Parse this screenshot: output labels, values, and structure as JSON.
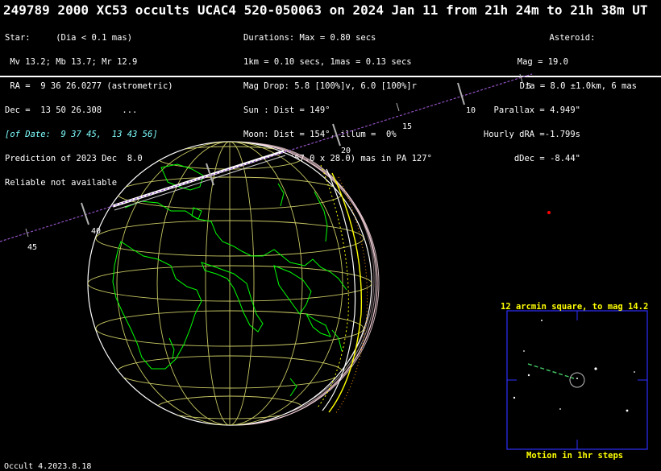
{
  "title": "249789 2000 XC53 occults UCAC4 520-050063 on 2024 Jan 11 from 21h 24m to 21h 38m UT",
  "star_block": [
    "Star:     (Dia < 0.1 mas)",
    " Mv 13.2; Mb 13.7; Mr 12.9",
    " RA =  9 36 26.0277 (astrometric)",
    "Dec =  13 50 26.308    ...",
    "[of Date:  9 37 45,  13 43 56]",
    "Prediction of 2023 Dec  8.0",
    "Reliable not available"
  ],
  "event_block": [
    "Durations: Max = 0.80 secs",
    "1km = 0.10 secs, 1mas = 0.13 secs",
    "Mag Drop: 5.8 [100%]v, 6.0 [100%]r",
    "Sun : Dist = 149°",
    "Moon: Dist = 154°, illum =  0%",
    "1σ Err: ±(57.0 x 28.0) mas in PA 127°"
  ],
  "asteroid_block": [
    "Asteroid:",
    "Mag = 19.0",
    "Dia = 8.0 ±1.0km, 6 mas",
    "Parallax = 4.949\"",
    "Hourly dRA =-1.799s",
    "dDec = -8.44\""
  ],
  "path_time_labels": [
    "5",
    "10",
    "15",
    "20",
    "40",
    "45"
  ],
  "finder": {
    "title": "12 arcmin square, to mag 14.2",
    "footer": "Motion in 1hr steps"
  },
  "version": "Occult 4.2023.8.18",
  "colors": {
    "background": "#000000",
    "text": "#ffffff",
    "coastline": "#00ff00",
    "graticule": "#c8c864",
    "path_line": "#9050c0",
    "shadow_edge": "#ffffff",
    "finder_box": "#0000ff",
    "finder_text": "#ffff00",
    "date_text": "#80ffff"
  }
}
